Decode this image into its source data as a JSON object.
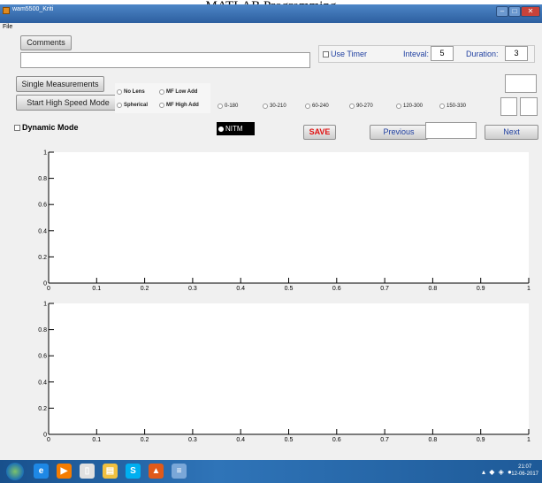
{
  "caption": "MATLAB Programming",
  "window": {
    "title": "wam5500_Kriti"
  },
  "menu": {
    "file": "File"
  },
  "comments": {
    "label": "Comments",
    "value": ""
  },
  "timer": {
    "use_timer_label": "Use Timer",
    "interval_label": "Inteval:",
    "interval_value": "5",
    "duration_label": "Duration:",
    "duration_value": "3"
  },
  "buttons": {
    "single": "Single Measurements",
    "high_speed": "Start High Speed Mode",
    "save": "SAVE",
    "previous": "Previous",
    "next": "Next"
  },
  "dynamic_mode": "Dynamic Mode",
  "lens_options": [
    "No Lens",
    "MF Low Add",
    "Spherical",
    "MF High Add"
  ],
  "range_options": [
    "0-180",
    "30-210",
    "60-240",
    "90-270",
    "120-300",
    "150-330"
  ],
  "nitm_label": "NITM",
  "page_sep": "/",
  "charts": {
    "chart_data": [
      {
        "type": "line",
        "xlim": [
          0,
          1
        ],
        "ylim": [
          0,
          1
        ],
        "xticks": [
          "0",
          "0.1",
          "0.2",
          "0.3",
          "0.4",
          "0.5",
          "0.6",
          "0.7",
          "0.8",
          "0.9",
          "1"
        ],
        "yticks": [
          "0",
          "0.2",
          "0.4",
          "0.6",
          "0.8",
          "1"
        ],
        "series": []
      },
      {
        "type": "line",
        "xlim": [
          0,
          1
        ],
        "ylim": [
          0,
          1
        ],
        "xticks": [
          "0",
          "0.1",
          "0.2",
          "0.3",
          "0.4",
          "0.5",
          "0.6",
          "0.7",
          "0.8",
          "0.9",
          "1"
        ],
        "yticks": [
          "0",
          "0.2",
          "0.4",
          "0.6",
          "0.8",
          "1"
        ],
        "series": []
      }
    ]
  },
  "taskbar": {
    "icons": [
      {
        "name": "ie-icon",
        "glyph": "e",
        "color": "#1e88e5"
      },
      {
        "name": "media-player-icon",
        "glyph": "▶",
        "color": "#f57c00"
      },
      {
        "name": "document-icon",
        "glyph": "▯",
        "color": "#e0e0e0"
      },
      {
        "name": "folder-icon",
        "glyph": "▤",
        "color": "#f0c040"
      },
      {
        "name": "skype-icon",
        "glyph": "S",
        "color": "#00aff0"
      },
      {
        "name": "matlab-icon",
        "glyph": "▲",
        "color": "#e05a1a"
      },
      {
        "name": "notepad-icon",
        "glyph": "≡",
        "color": "#7aa7d8"
      }
    ],
    "tray": "▴ ◆ ◈ ●",
    "time": "21:07",
    "date": "12-06-2017"
  }
}
